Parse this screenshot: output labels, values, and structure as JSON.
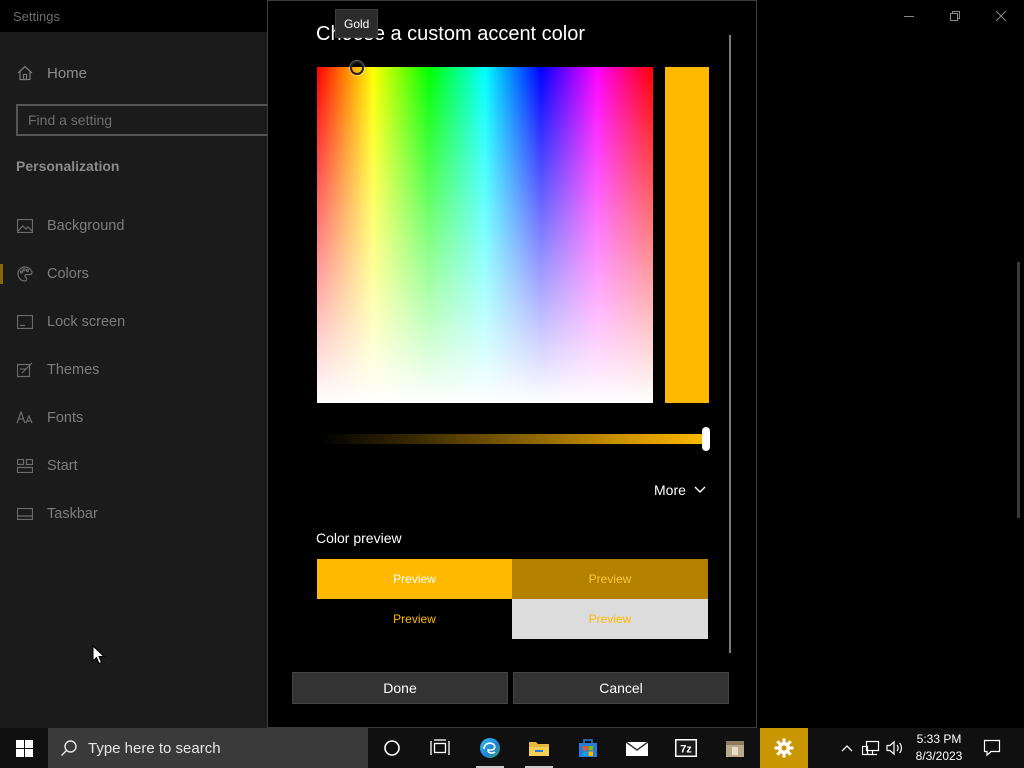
{
  "settings": {
    "window_title": "Settings",
    "home_label": "Home",
    "search_placeholder": "Find a setting",
    "section_title": "Personalization",
    "nav_items": [
      {
        "label": "Background",
        "icon": "picture-icon"
      },
      {
        "label": "Colors",
        "icon": "palette-icon",
        "selected": true
      },
      {
        "label": "Lock screen",
        "icon": "lock-screen-icon"
      },
      {
        "label": "Themes",
        "icon": "themes-icon"
      },
      {
        "label": "Fonts",
        "icon": "fonts-icon"
      },
      {
        "label": "Start",
        "icon": "start-icon"
      },
      {
        "label": "Taskbar",
        "icon": "taskbar-icon"
      }
    ]
  },
  "dialog": {
    "title": "Choose a custom accent color",
    "tooltip": "Gold",
    "selected_color": "#FFB900",
    "brightness": 1.0,
    "more_label": "More",
    "preview_label": "Color preview",
    "previews": [
      "Preview",
      "Preview",
      "Preview",
      "Preview"
    ],
    "done_label": "Done",
    "cancel_label": "Cancel"
  },
  "taskbar": {
    "search_placeholder": "Type here to search",
    "pinned": [
      "cortana-icon",
      "task-view-icon",
      "edge-icon",
      "file-explorer-icon",
      "store-icon",
      "mail-icon",
      "7zip-icon",
      "archive-icon",
      "settings-icon"
    ],
    "clock_time": "5:33 PM",
    "clock_date": "8/3/2023"
  },
  "colors": {
    "accent": "#FFB900",
    "accent_dark": "#B38000",
    "active_taskbar": "#C79600"
  }
}
